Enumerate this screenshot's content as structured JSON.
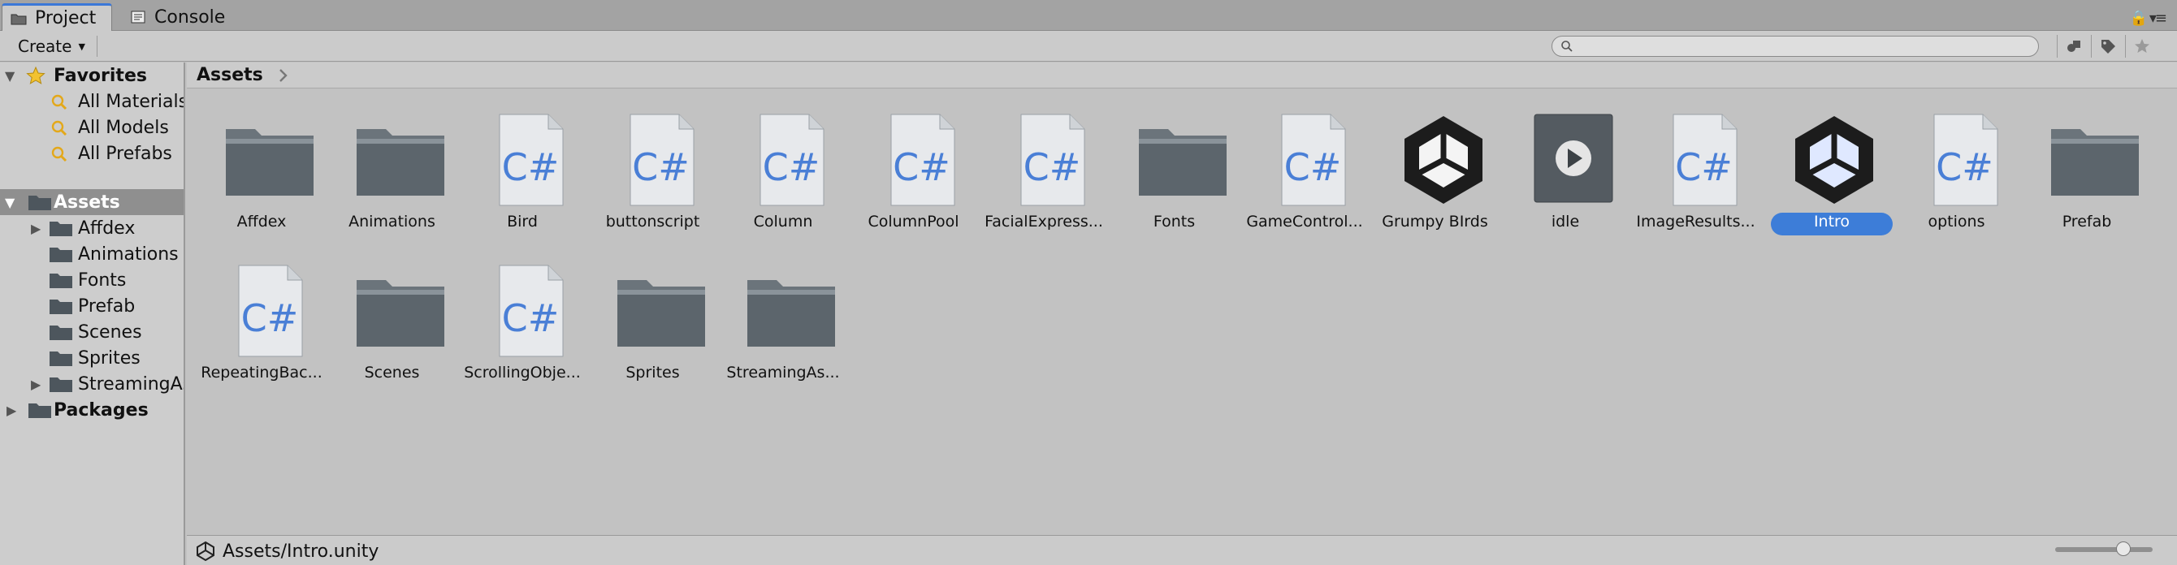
{
  "tabs": [
    {
      "label": "Project",
      "icon": "folder-icon",
      "active": true
    },
    {
      "label": "Console",
      "icon": "console-icon",
      "active": false
    }
  ],
  "toolbar": {
    "create_label": "Create",
    "search_placeholder": "",
    "icons": [
      "filter-by-type-icon",
      "filter-by-label-icon",
      "favorite-star-icon"
    ]
  },
  "sidebar": {
    "favorites": {
      "label": "Favorites",
      "items": [
        "All Materials",
        "All Models",
        "All Prefabs"
      ]
    },
    "assets": {
      "label": "Assets",
      "children": [
        {
          "label": "Affdex",
          "expandable": true
        },
        {
          "label": "Animations",
          "expandable": false
        },
        {
          "label": "Fonts",
          "expandable": false
        },
        {
          "label": "Prefab",
          "expandable": false
        },
        {
          "label": "Scenes",
          "expandable": false
        },
        {
          "label": "Sprites",
          "expandable": false
        },
        {
          "label": "StreamingAs",
          "expandable": true
        }
      ]
    },
    "packages": {
      "label": "Packages"
    }
  },
  "breadcrumb": {
    "label": "Assets"
  },
  "assets": [
    {
      "name": "Affdex",
      "type": "folder"
    },
    {
      "name": "Animations",
      "type": "folder"
    },
    {
      "name": "Bird",
      "type": "script"
    },
    {
      "name": "buttonscript",
      "type": "script"
    },
    {
      "name": "Column",
      "type": "script"
    },
    {
      "name": "ColumnPool",
      "type": "script"
    },
    {
      "name": "FacialExpress...",
      "type": "script"
    },
    {
      "name": "Fonts",
      "type": "folder"
    },
    {
      "name": "GameControl...",
      "type": "script"
    },
    {
      "name": "Grumpy BIrds",
      "type": "unity"
    },
    {
      "name": "idle",
      "type": "anim"
    },
    {
      "name": "ImageResults...",
      "type": "script"
    },
    {
      "name": "Intro",
      "type": "unity",
      "selected": true
    },
    {
      "name": "options",
      "type": "script"
    },
    {
      "name": "Prefab",
      "type": "folder"
    },
    {
      "name": "RepeatingBac...",
      "type": "script"
    },
    {
      "name": "Scenes",
      "type": "folder"
    },
    {
      "name": "ScrollingObje...",
      "type": "script"
    },
    {
      "name": "Sprites",
      "type": "folder"
    },
    {
      "name": "StreamingAs...",
      "type": "folder"
    }
  ],
  "status": {
    "path": "Assets/Intro.unity",
    "zoom": 0.7
  },
  "script_glyph": "C#",
  "colors": {
    "selection": "#3d7dd8",
    "script_text": "#4a7fd6",
    "folder": "#5c656c"
  }
}
